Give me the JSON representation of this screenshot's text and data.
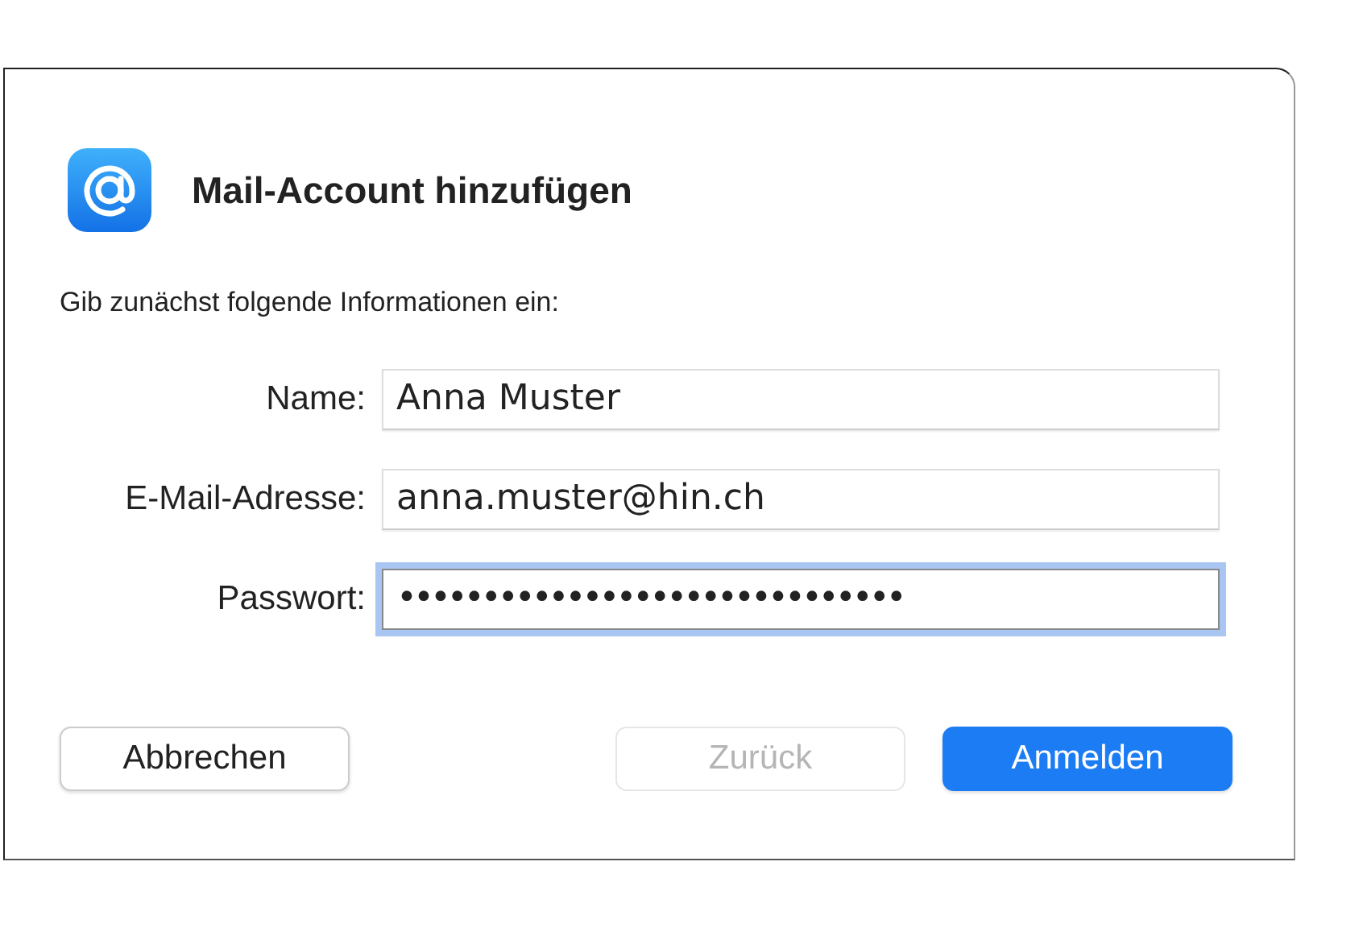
{
  "dialog": {
    "title": "Mail-Account hinzufügen",
    "instruction": "Gib zunächst folgende Informationen ein:"
  },
  "fields": [
    {
      "label": "Name:",
      "value": "Anna Muster",
      "focused": false
    },
    {
      "label": "E-Mail-Adresse:",
      "value": "anna.muster@hin.ch",
      "focused": false
    },
    {
      "label": "Passwort:",
      "value": "••••••••••••••••••••••••••••••",
      "focused": true
    }
  ],
  "buttons": [
    {
      "label": "Abbrechen",
      "kind": "default",
      "disabled": false
    },
    {
      "label": "Zurück",
      "kind": "default",
      "disabled": true
    },
    {
      "label": "Anmelden",
      "kind": "primary",
      "disabled": false
    }
  ]
}
